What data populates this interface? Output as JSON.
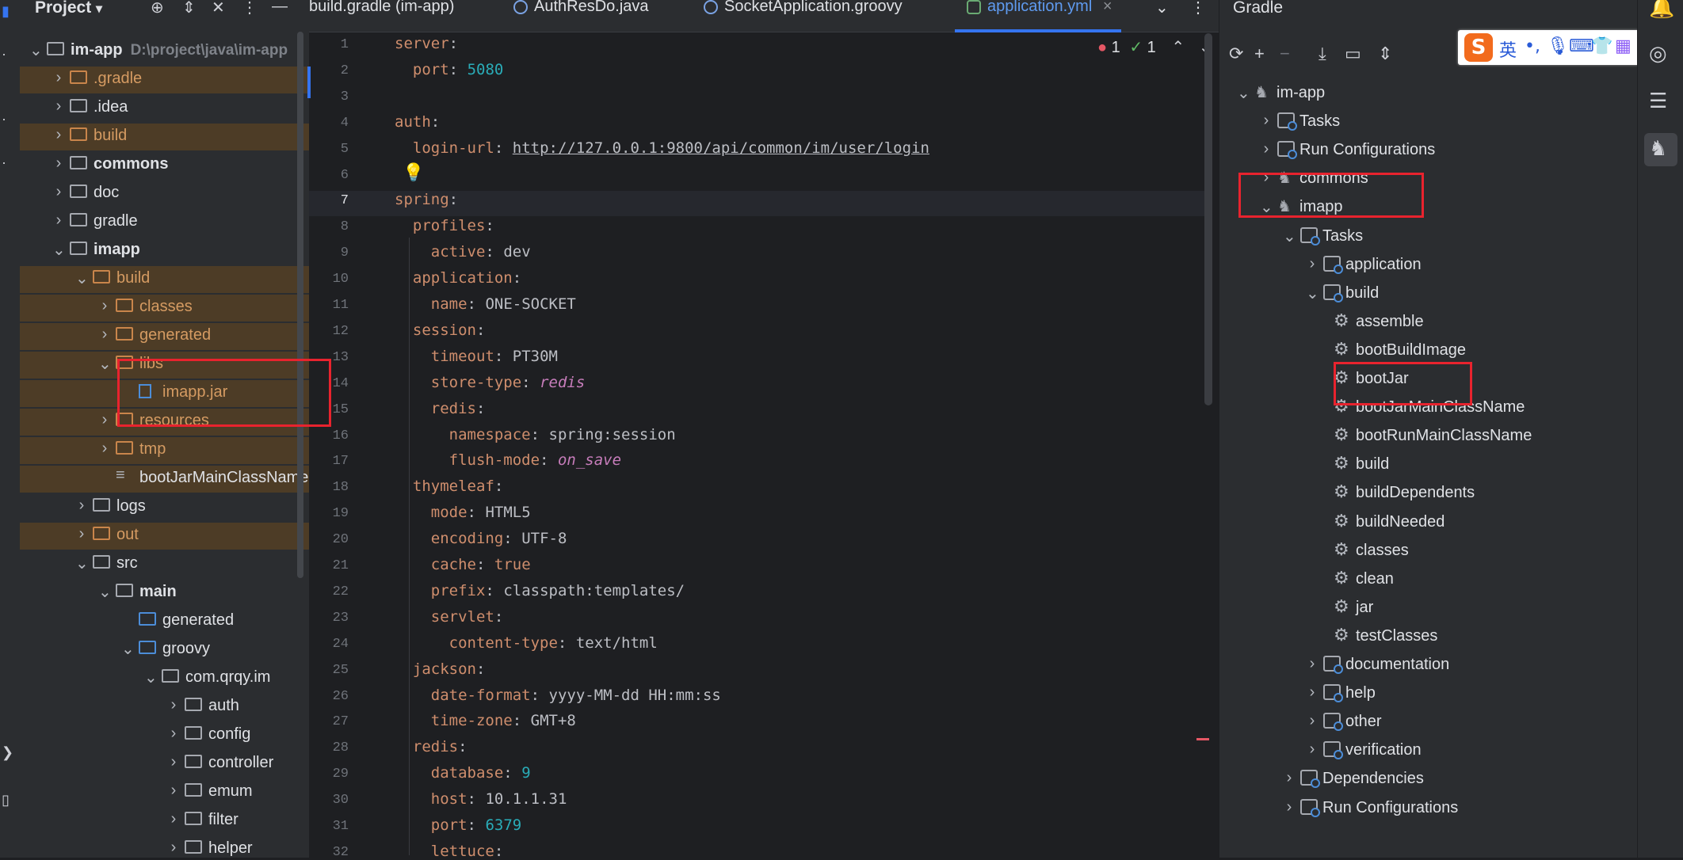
{
  "project_panel": {
    "title": "Project",
    "tree": [
      {
        "label": "im-app",
        "path": "D:\\project\\java\\im-app",
        "depth": 0,
        "expanded": true,
        "type": "module",
        "bold": true
      },
      {
        "label": ".gradle",
        "depth": 1,
        "expanded": false,
        "type": "folder-excluded",
        "highlight": true
      },
      {
        "label": ".idea",
        "depth": 1,
        "expanded": false,
        "type": "folder"
      },
      {
        "label": "build",
        "depth": 1,
        "expanded": false,
        "type": "folder-excluded",
        "highlight": true
      },
      {
        "label": "commons",
        "depth": 1,
        "expanded": false,
        "type": "module",
        "bold": true
      },
      {
        "label": "doc",
        "depth": 1,
        "expanded": false,
        "type": "folder"
      },
      {
        "label": "gradle",
        "depth": 1,
        "expanded": false,
        "type": "folder"
      },
      {
        "label": "imapp",
        "depth": 1,
        "expanded": true,
        "type": "module",
        "bold": true
      },
      {
        "label": "build",
        "depth": 2,
        "expanded": true,
        "type": "folder-excluded",
        "highlight": true
      },
      {
        "label": "classes",
        "depth": 3,
        "expanded": false,
        "type": "folder-excluded",
        "highlight": true
      },
      {
        "label": "generated",
        "depth": 3,
        "expanded": false,
        "type": "folder-excluded",
        "highlight": true
      },
      {
        "label": "libs",
        "depth": 3,
        "expanded": true,
        "type": "folder-excluded",
        "highlight": true
      },
      {
        "label": "imapp.jar",
        "depth": 4,
        "type": "jar",
        "highlight": true
      },
      {
        "label": "resources",
        "depth": 3,
        "expanded": false,
        "type": "folder-excluded",
        "highlight": true
      },
      {
        "label": "tmp",
        "depth": 3,
        "expanded": false,
        "type": "folder-excluded",
        "highlight": true
      },
      {
        "label": "bootJarMainClassName",
        "depth": 3,
        "type": "file",
        "highlight": true
      },
      {
        "label": "logs",
        "depth": 2,
        "expanded": false,
        "type": "folder"
      },
      {
        "label": "out",
        "depth": 2,
        "expanded": false,
        "type": "folder-excluded",
        "highlight": true
      },
      {
        "label": "src",
        "depth": 2,
        "expanded": true,
        "type": "folder"
      },
      {
        "label": "main",
        "depth": 3,
        "expanded": true,
        "type": "module",
        "bold": true
      },
      {
        "label": "generated",
        "depth": 4,
        "type": "folder-source"
      },
      {
        "label": "groovy",
        "depth": 4,
        "expanded": true,
        "type": "folder-source"
      },
      {
        "label": "com.qrqy.im",
        "depth": 5,
        "expanded": true,
        "type": "package"
      },
      {
        "label": "auth",
        "depth": 6,
        "expanded": false,
        "type": "package"
      },
      {
        "label": "config",
        "depth": 6,
        "expanded": false,
        "type": "package"
      },
      {
        "label": "controller",
        "depth": 6,
        "expanded": false,
        "type": "package"
      },
      {
        "label": "emum",
        "depth": 6,
        "expanded": false,
        "type": "package"
      },
      {
        "label": "filter",
        "depth": 6,
        "expanded": false,
        "type": "package"
      },
      {
        "label": "helper",
        "depth": 6,
        "expanded": false,
        "type": "package"
      }
    ]
  },
  "editor": {
    "tabs": [
      {
        "label": "build.gradle (im-app)",
        "active": false
      },
      {
        "label": "AuthResDo.java",
        "active": false
      },
      {
        "label": "SocketApplication.groovy",
        "active": false
      },
      {
        "label": "application.yml",
        "active": true
      }
    ],
    "indicators": {
      "errors": "1",
      "checks": "1"
    },
    "current_line": 7,
    "lines": [
      {
        "n": "1",
        "text": "server:"
      },
      {
        "n": "2",
        "text": "  port: 5080"
      },
      {
        "n": "3",
        "text": ""
      },
      {
        "n": "4",
        "text": "auth:"
      },
      {
        "n": "5",
        "text": "  login-url: http://127.0.0.1:9800/api/common/im/user/login"
      },
      {
        "n": "6",
        "text": ""
      },
      {
        "n": "7",
        "text": "spring:"
      },
      {
        "n": "8",
        "text": "  profiles:"
      },
      {
        "n": "9",
        "text": "    active: dev"
      },
      {
        "n": "10",
        "text": "  application:"
      },
      {
        "n": "11",
        "text": "    name: ONE-SOCKET"
      },
      {
        "n": "12",
        "text": "  session:"
      },
      {
        "n": "13",
        "text": "    timeout: PT30M"
      },
      {
        "n": "14",
        "text": "    store-type: redis"
      },
      {
        "n": "15",
        "text": "    redis:"
      },
      {
        "n": "16",
        "text": "      namespace: spring:session"
      },
      {
        "n": "17",
        "text": "      flush-mode: on_save"
      },
      {
        "n": "18",
        "text": "  thymeleaf:"
      },
      {
        "n": "19",
        "text": "    mode: HTML5"
      },
      {
        "n": "20",
        "text": "    encoding: UTF-8"
      },
      {
        "n": "21",
        "text": "    cache: true"
      },
      {
        "n": "22",
        "text": "    prefix: classpath:templates/"
      },
      {
        "n": "23",
        "text": "    servlet:"
      },
      {
        "n": "24",
        "text": "      content-type: text/html"
      },
      {
        "n": "25",
        "text": "  jackson:"
      },
      {
        "n": "26",
        "text": "    date-format: yyyy-MM-dd HH:mm:ss"
      },
      {
        "n": "27",
        "text": "    time-zone: GMT+8"
      },
      {
        "n": "28",
        "text": "  redis:"
      },
      {
        "n": "29",
        "text": "    database: 9"
      },
      {
        "n": "30",
        "text": "    host: 10.1.1.31"
      },
      {
        "n": "31",
        "text": "    port: 6379"
      },
      {
        "n": "32",
        "text": "    lettuce:"
      }
    ]
  },
  "gradle_panel": {
    "title": "Gradle",
    "ime": {
      "logo": "S",
      "lang": "英",
      "punct": "•,"
    },
    "tree": [
      {
        "label": "im-app",
        "depth": 0,
        "expanded": true,
        "type": "project"
      },
      {
        "label": "Tasks",
        "depth": 1,
        "expanded": false,
        "type": "group"
      },
      {
        "label": "Run Configurations",
        "depth": 1,
        "expanded": false,
        "type": "group"
      },
      {
        "label": "commons",
        "depth": 1,
        "expanded": false,
        "type": "project"
      },
      {
        "label": "imapp",
        "depth": 1,
        "expanded": true,
        "type": "project"
      },
      {
        "label": "Tasks",
        "depth": 2,
        "expanded": true,
        "type": "group"
      },
      {
        "label": "application",
        "depth": 3,
        "expanded": false,
        "type": "group"
      },
      {
        "label": "build",
        "depth": 3,
        "expanded": true,
        "type": "group"
      },
      {
        "label": "assemble",
        "depth": 4,
        "type": "task"
      },
      {
        "label": "bootBuildImage",
        "depth": 4,
        "type": "task"
      },
      {
        "label": "bootJar",
        "depth": 4,
        "type": "task"
      },
      {
        "label": "bootJarMainClassName",
        "depth": 4,
        "type": "task"
      },
      {
        "label": "bootRunMainClassName",
        "depth": 4,
        "type": "task"
      },
      {
        "label": "build",
        "depth": 4,
        "type": "task"
      },
      {
        "label": "buildDependents",
        "depth": 4,
        "type": "task"
      },
      {
        "label": "buildNeeded",
        "depth": 4,
        "type": "task"
      },
      {
        "label": "classes",
        "depth": 4,
        "type": "task"
      },
      {
        "label": "clean",
        "depth": 4,
        "type": "task"
      },
      {
        "label": "jar",
        "depth": 4,
        "type": "task"
      },
      {
        "label": "testClasses",
        "depth": 4,
        "type": "task"
      },
      {
        "label": "documentation",
        "depth": 3,
        "expanded": false,
        "type": "group"
      },
      {
        "label": "help",
        "depth": 3,
        "expanded": false,
        "type": "group"
      },
      {
        "label": "other",
        "depth": 3,
        "expanded": false,
        "type": "group"
      },
      {
        "label": "verification",
        "depth": 3,
        "expanded": false,
        "type": "group"
      },
      {
        "label": "Dependencies",
        "depth": 2,
        "expanded": false,
        "type": "group"
      },
      {
        "label": "Run Configurations",
        "depth": 2,
        "expanded": false,
        "type": "group"
      }
    ]
  },
  "colors": {
    "annotation_red": "#e8232e",
    "excluded_folder": "#d59b62",
    "keyword": "#cf8e6d",
    "number": "#2aacb8",
    "italic_value": "#c77dbb",
    "active_tab": "#5f9bf0"
  }
}
